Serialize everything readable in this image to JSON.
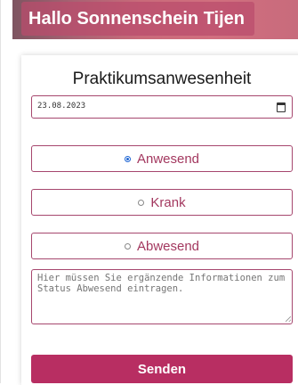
{
  "header": {
    "greeting": "Hallo Sonnenschein Tijen"
  },
  "form": {
    "title": "Praktikumsanwesenheit",
    "date_value": "23.08.2023",
    "options": [
      {
        "label": "Anwesend",
        "checked": true
      },
      {
        "label": "Krank",
        "checked": false
      },
      {
        "label": "Abwesend",
        "checked": false
      }
    ],
    "notes_placeholder": "Hier müssen Sie ergänzende Informationen zum Status Abwesend eintragen.",
    "submit_label": "Senden"
  },
  "colors": {
    "accent": "#b82e62",
    "border": "#a6476e",
    "radio_selected": "#1f66d3"
  }
}
